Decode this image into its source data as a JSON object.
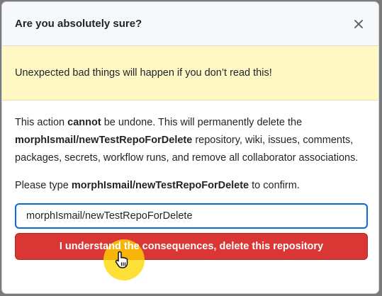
{
  "dialog": {
    "title": "Are you absolutely sure?",
    "close_icon": "close-icon",
    "warning": "Unexpected bad things will happen if you don’t read this!",
    "body": {
      "p1_before": "This action ",
      "p1_bold": "cannot",
      "p1_after": " be undone. This will permanently delete the",
      "repo": "morphIsmail/newTestRepoForDelete",
      "p1_rest": " repository, wiki, issues, comments, packages, secrets, workflow runs, and remove all collaborator associations.",
      "confirm_before": "Please type ",
      "confirm_repo": "morphIsmail/newTestRepoForDelete",
      "confirm_after": " to confirm."
    },
    "input": {
      "value": "morphIsmail/newTestRepoForDelete"
    },
    "danger_button": {
      "label": "I understand the consequences, delete this repository"
    }
  },
  "colors": {
    "warning_bg": "#fff8c5",
    "danger": "#da3633",
    "focus_border": "#0969da"
  },
  "cursor": {
    "icon": "hand-pointer-icon"
  }
}
